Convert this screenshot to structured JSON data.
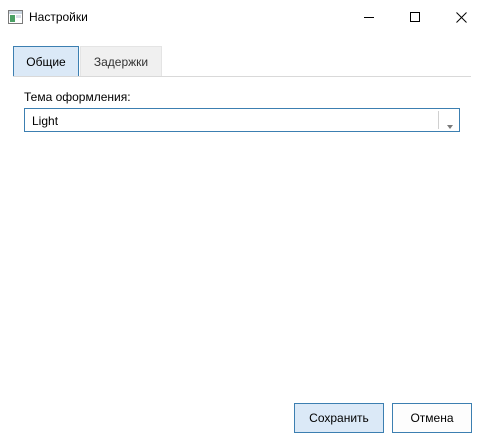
{
  "window": {
    "title": "Настройки",
    "icon": "settings-window-icon"
  },
  "titlebar_controls": [
    "minimize-icon",
    "maximize-icon",
    "close-icon"
  ],
  "tabs": [
    {
      "label": "Общие",
      "selected": true
    },
    {
      "label": "Задержки",
      "selected": false
    }
  ],
  "general": {
    "theme_label": "Тема оформления:",
    "theme_value": "Light"
  },
  "footer": {
    "save_label": "Сохранить",
    "cancel_label": "Отмена"
  },
  "colors": {
    "accent_border": "#3c7fb1",
    "selected_fill": "#dbe9f7"
  }
}
